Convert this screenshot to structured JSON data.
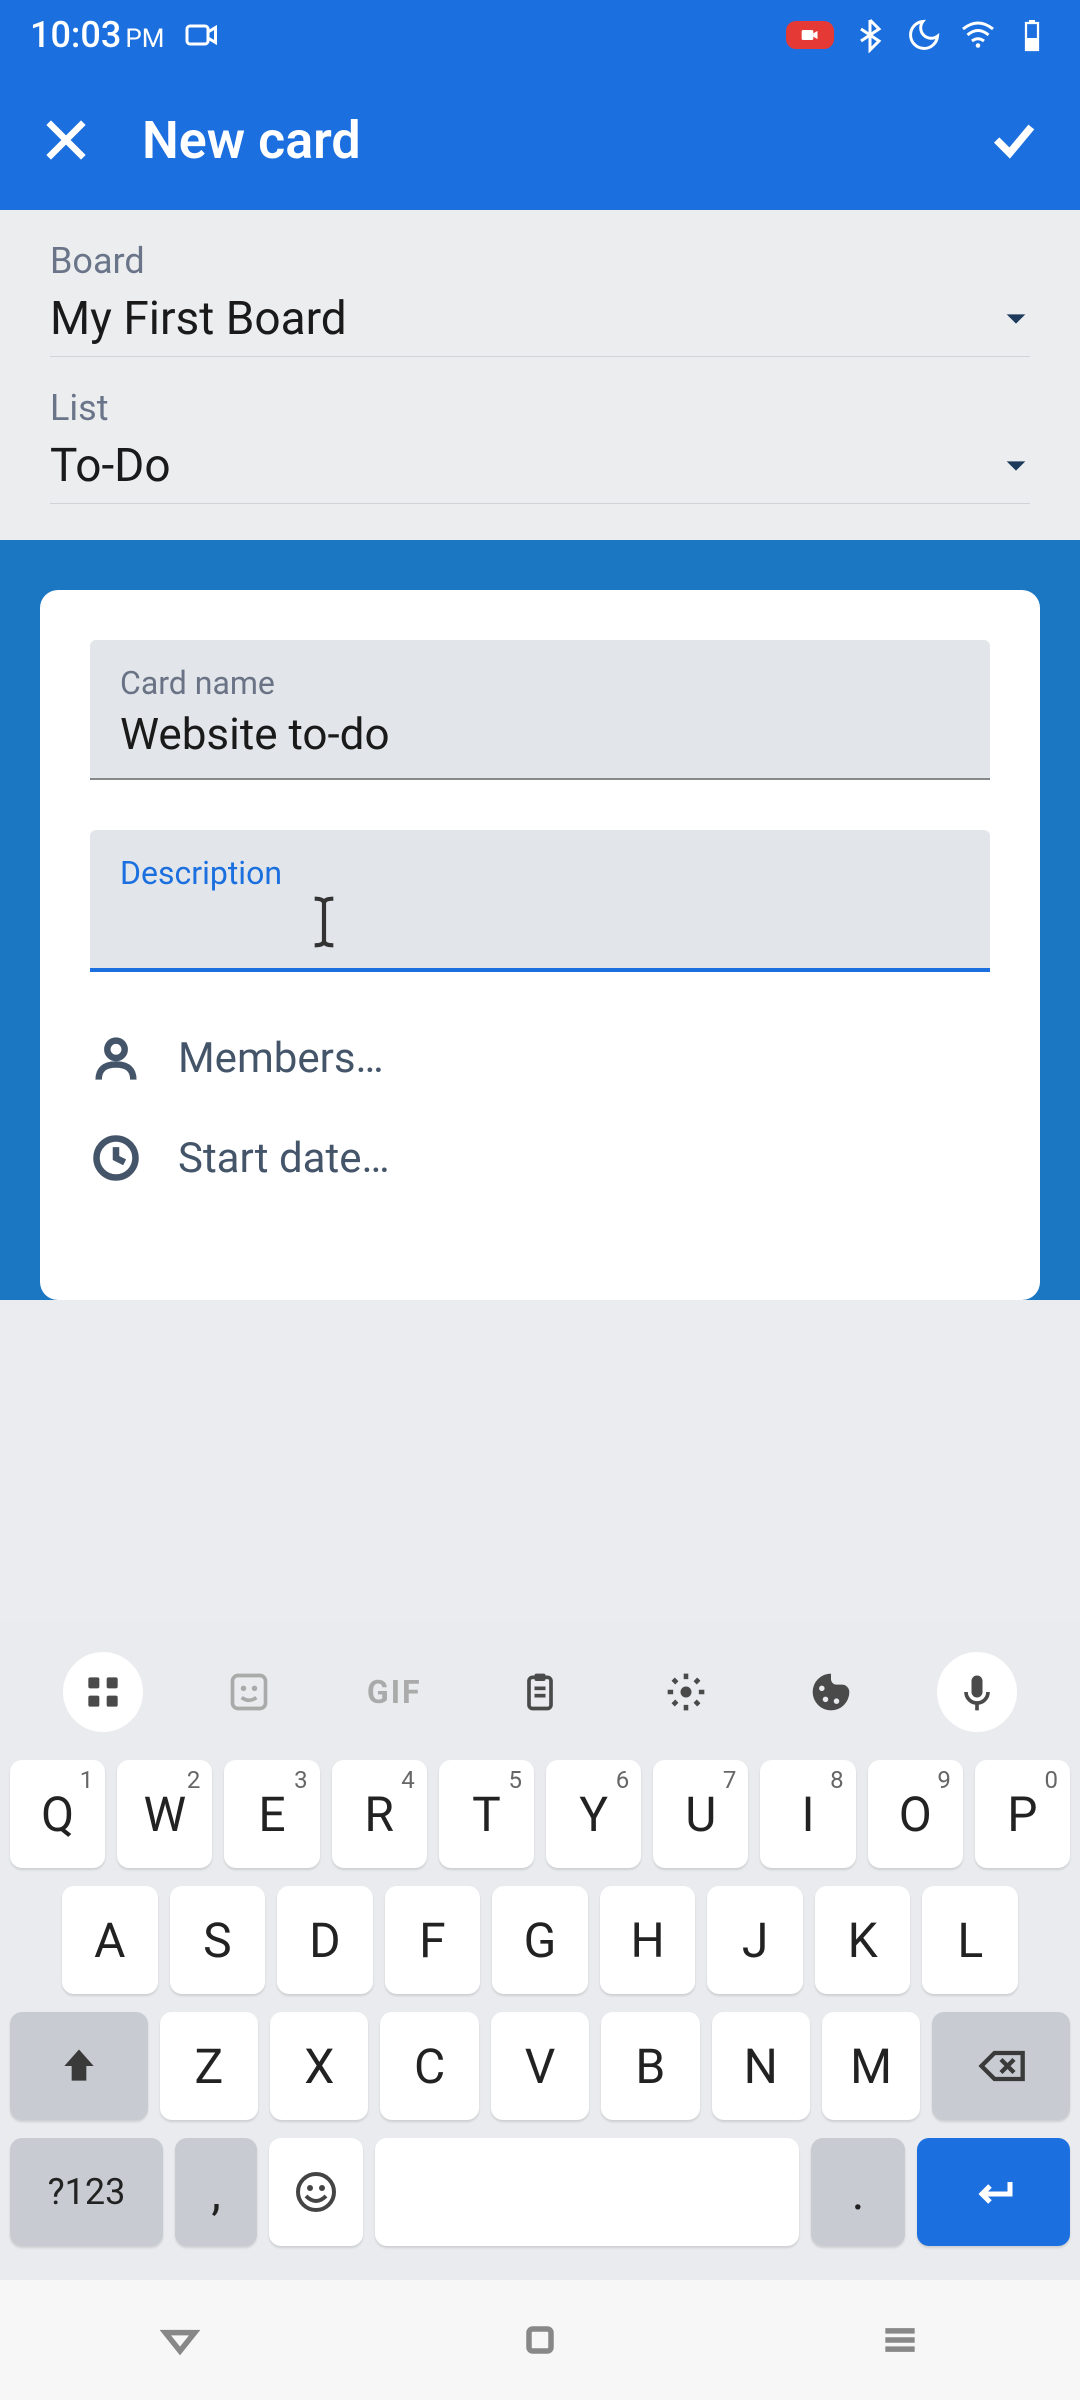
{
  "status": {
    "time": "10:03",
    "period": "PM"
  },
  "appbar": {
    "title": "New card"
  },
  "selectors": {
    "board_label": "Board",
    "board_value": "My First Board",
    "list_label": "List",
    "list_value": "To-Do"
  },
  "form": {
    "cardname_label": "Card name",
    "cardname_value": "Website to-do",
    "description_label": "Description",
    "description_value": "",
    "members_label": "Members…",
    "startdate_label": "Start date…"
  },
  "keyboard": {
    "gif": "GIF",
    "row1": [
      {
        "k": "Q",
        "s": "1"
      },
      {
        "k": "W",
        "s": "2"
      },
      {
        "k": "E",
        "s": "3"
      },
      {
        "k": "R",
        "s": "4"
      },
      {
        "k": "T",
        "s": "5"
      },
      {
        "k": "Y",
        "s": "6"
      },
      {
        "k": "U",
        "s": "7"
      },
      {
        "k": "I",
        "s": "8"
      },
      {
        "k": "O",
        "s": "9"
      },
      {
        "k": "P",
        "s": "0"
      }
    ],
    "row2": [
      "A",
      "S",
      "D",
      "F",
      "G",
      "H",
      "J",
      "K",
      "L"
    ],
    "row3": [
      "Z",
      "X",
      "C",
      "V",
      "B",
      "N",
      "M"
    ],
    "sym": "?123",
    "comma": ",",
    "period": "."
  }
}
